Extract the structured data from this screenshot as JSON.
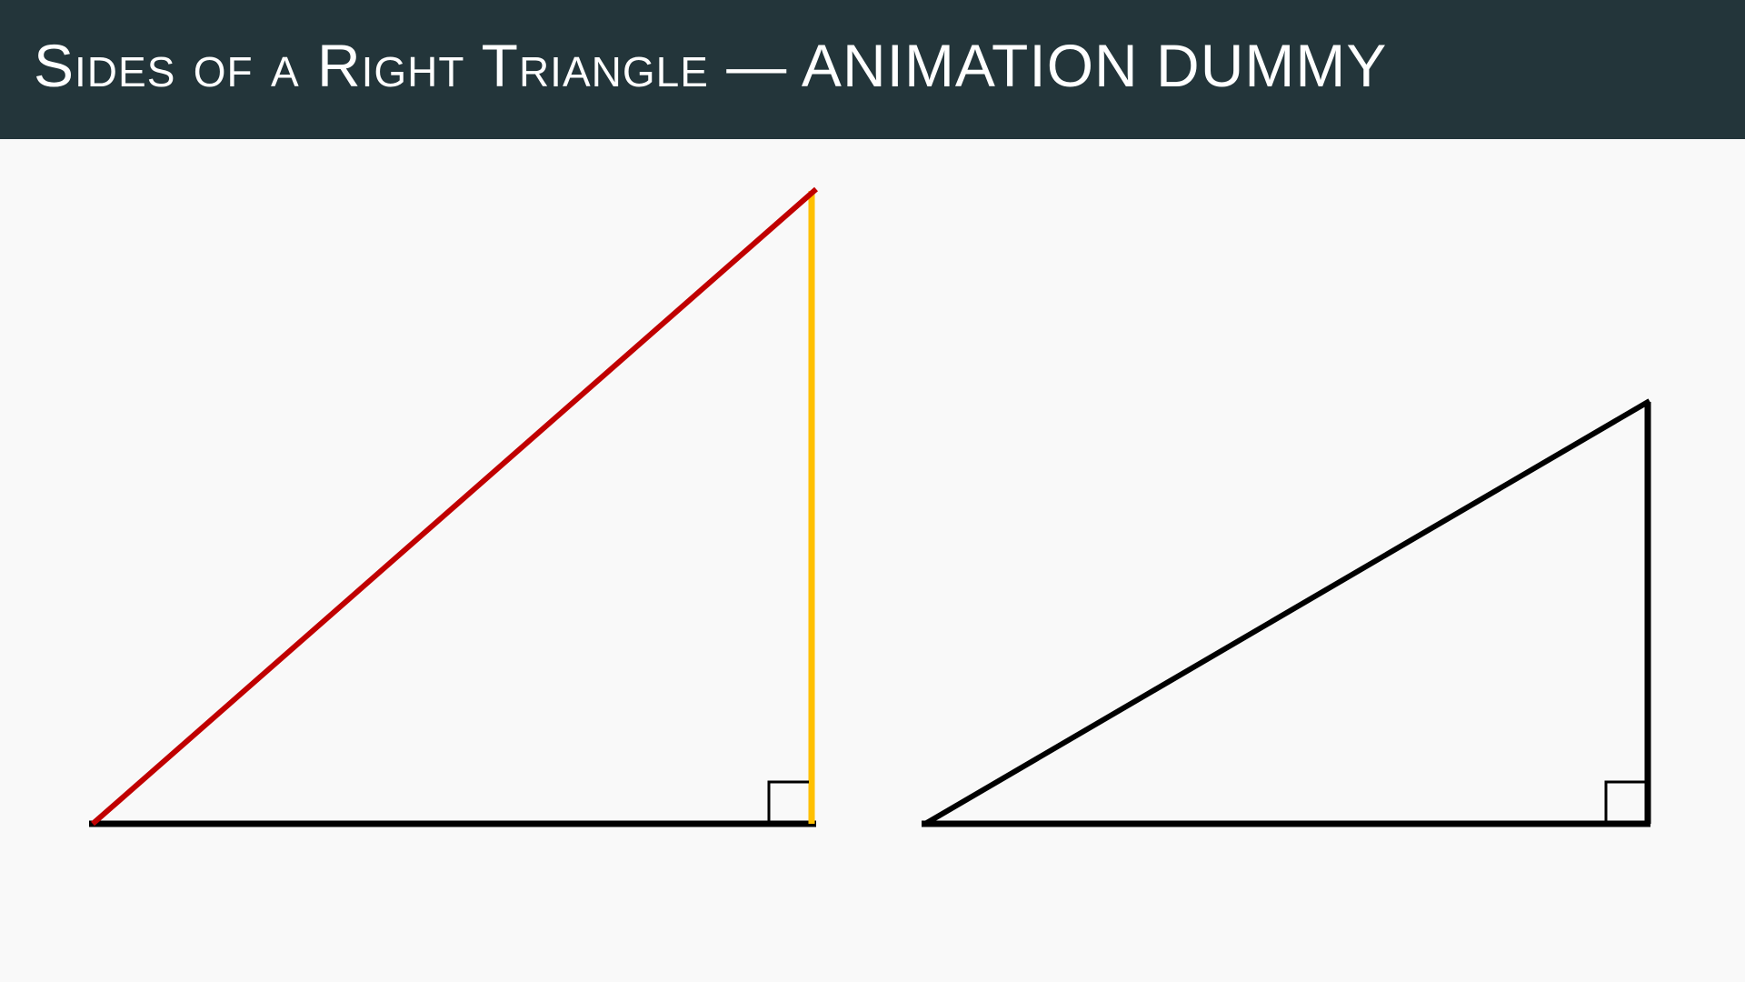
{
  "header": {
    "title": "Sides of a Right Triangle — ANIMATION DUMMY"
  },
  "colors": {
    "header_background": "#23353a",
    "canvas_background": "#f9f9f9",
    "hypotenuse": "#c00000",
    "vertical_leg": "#ffc000",
    "outline": "#000000"
  },
  "triangles": [
    {
      "name": "left-triangle",
      "highlighted_sides": [
        "hypotenuse",
        "vertical-leg"
      ],
      "right_angle_marker": true
    },
    {
      "name": "right-triangle",
      "highlighted_sides": [],
      "right_angle_marker": true
    }
  ]
}
